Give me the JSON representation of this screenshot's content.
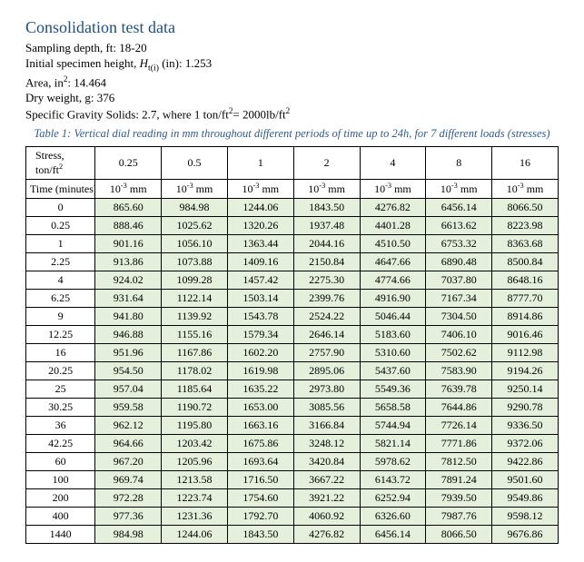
{
  "title": "Consolidation test data",
  "meta": {
    "line1_label": "Sampling depth, ft: ",
    "line1_val": "18-20",
    "line2_pre": "Initial specimen height, ",
    "line2_sym": "H",
    "line2_sub": "t(i)",
    "line2_mid": " (in): ",
    "line2_val": "1.253",
    "line3_pre": "Area, in",
    "line3_sup": "2",
    "line3_mid": ": ",
    "line3_val": "14.464",
    "line4_label": "Dry weight, g: ",
    "line4_val": "376",
    "line5_pre": "Specific Gravity Solids: 2.7, where 1 ton/ft",
    "line5_sup1": "2",
    "line5_mid": "= 2000lb/ft",
    "line5_sup2": "2"
  },
  "caption": "Table 1: Vertical dial reading in mm throughout different periods of time up to 24h, for 7 different loads (stresses)",
  "header": {
    "stress_line1": "Stress,",
    "stress_line2_pre": "ton/ft",
    "stress_line2_sup": "2",
    "time_label": "Time (minutes)",
    "loads": [
      "0.25",
      "0.5",
      "1",
      "2",
      "4",
      "8",
      "16"
    ],
    "unit_pre": "10",
    "unit_sup": "-3",
    "unit_post": " mm"
  },
  "rows": [
    {
      "t": "0",
      "v": [
        "865.60",
        "984.98",
        "1244.06",
        "1843.50",
        "4276.82",
        "6456.14",
        "8066.50"
      ]
    },
    {
      "t": "0.25",
      "v": [
        "888.46",
        "1025.62",
        "1320.26",
        "1937.48",
        "4401.28",
        "6613.62",
        "8223.98"
      ]
    },
    {
      "t": "1",
      "v": [
        "901.16",
        "1056.10",
        "1363.44",
        "2044.16",
        "4510.50",
        "6753.32",
        "8363.68"
      ]
    },
    {
      "t": "2.25",
      "v": [
        "913.86",
        "1073.88",
        "1409.16",
        "2150.84",
        "4647.66",
        "6890.48",
        "8500.84"
      ]
    },
    {
      "t": "4",
      "v": [
        "924.02",
        "1099.28",
        "1457.42",
        "2275.30",
        "4774.66",
        "7037.80",
        "8648.16"
      ]
    },
    {
      "t": "6.25",
      "v": [
        "931.64",
        "1122.14",
        "1503.14",
        "2399.76",
        "4916.90",
        "7167.34",
        "8777.70"
      ]
    },
    {
      "t": "9",
      "v": [
        "941.80",
        "1139.92",
        "1543.78",
        "2524.22",
        "5046.44",
        "7304.50",
        "8914.86"
      ]
    },
    {
      "t": "12.25",
      "v": [
        "946.88",
        "1155.16",
        "1579.34",
        "2646.14",
        "5183.60",
        "7406.10",
        "9016.46"
      ]
    },
    {
      "t": "16",
      "v": [
        "951.96",
        "1167.86",
        "1602.20",
        "2757.90",
        "5310.60",
        "7502.62",
        "9112.98"
      ]
    },
    {
      "t": "20.25",
      "v": [
        "954.50",
        "1178.02",
        "1619.98",
        "2895.06",
        "5437.60",
        "7583.90",
        "9194.26"
      ]
    },
    {
      "t": "25",
      "v": [
        "957.04",
        "1185.64",
        "1635.22",
        "2973.80",
        "5549.36",
        "7639.78",
        "9250.14"
      ]
    },
    {
      "t": "30.25",
      "v": [
        "959.58",
        "1190.72",
        "1653.00",
        "3085.56",
        "5658.58",
        "7644.86",
        "9290.78"
      ]
    },
    {
      "t": "36",
      "v": [
        "962.12",
        "1195.80",
        "1663.16",
        "3166.84",
        "5744.94",
        "7726.14",
        "9336.50"
      ]
    },
    {
      "t": "42.25",
      "v": [
        "964.66",
        "1203.42",
        "1675.86",
        "3248.12",
        "5821.14",
        "7771.86",
        "9372.06"
      ]
    },
    {
      "t": "60",
      "v": [
        "967.20",
        "1205.96",
        "1693.64",
        "3420.84",
        "5978.62",
        "7812.50",
        "9422.86"
      ]
    },
    {
      "t": "100",
      "v": [
        "969.74",
        "1213.58",
        "1716.50",
        "3667.22",
        "6143.72",
        "7891.24",
        "9501.60"
      ]
    },
    {
      "t": "200",
      "v": [
        "972.28",
        "1223.74",
        "1754.60",
        "3921.22",
        "6252.94",
        "7939.50",
        "9549.86"
      ]
    },
    {
      "t": "400",
      "v": [
        "977.36",
        "1231.36",
        "1792.70",
        "4060.92",
        "6326.60",
        "7987.76",
        "9598.12"
      ]
    },
    {
      "t": "1440",
      "v": [
        "984.98",
        "1244.06",
        "1843.50",
        "4276.82",
        "6456.14",
        "8066.50",
        "9676.86"
      ]
    }
  ]
}
